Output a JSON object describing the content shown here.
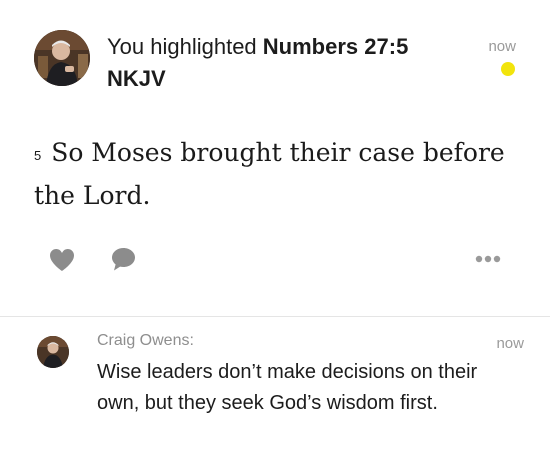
{
  "activity": {
    "headline_prefix": "You highlighted",
    "reference": "Numbers 27:5 NKJV",
    "time": "now",
    "highlight_color": "#f2e40c",
    "verse_number": "5",
    "verse_text": "So Moses brought their case before the Lord.",
    "actions": {
      "like_icon": "heart-icon",
      "comment_icon": "speech-bubble-icon",
      "more_icon": "more-dots-icon"
    }
  },
  "comment": {
    "author": "Craig Owens:",
    "time": "now",
    "text": "Wise leaders don’t make decisions on their own, but they seek God’s wisdom first."
  }
}
